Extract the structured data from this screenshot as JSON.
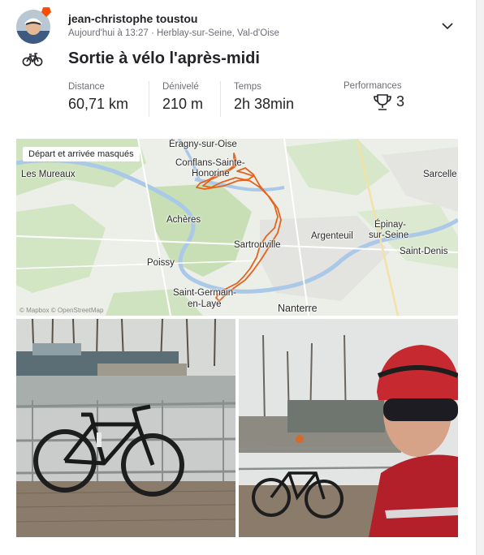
{
  "athlete": {
    "name": "jean-christophe toustou",
    "meta": "Aujourd'hui à 13:27 · Herblay-sur-Seine, Val-d'Oise"
  },
  "activity": {
    "title": "Sortie à vélo l'après-midi",
    "type_icon": "bike-icon"
  },
  "stats": [
    {
      "label": "Distance",
      "value": "60,71 km"
    },
    {
      "label": "Dénivelé",
      "value": "210 m"
    },
    {
      "label": "Temps",
      "value": "2h 38min"
    },
    {
      "label": "Performances",
      "value": "3",
      "icon": "trophy-icon"
    }
  ],
  "map": {
    "chip": "Départ et arrivée masqués",
    "attribution": "© Mapbox © OpenStreetMap",
    "route_color": "#e2641e",
    "places": [
      "Éragny-sur-Oise",
      "Conflans-Sainte-",
      "Honorine",
      "Les Mureaux",
      "Sarcelle",
      "Achères",
      "Épinay-",
      "sur-Seine",
      "Argenteuil",
      "Sartrouville",
      "Saint-Denis",
      "Poissy",
      "Saint-Germain-",
      "en-Laye",
      "Nanterre"
    ]
  },
  "colors": {
    "accent": "#fc4c02",
    "text": "#242428",
    "muted": "#6d6d78"
  }
}
